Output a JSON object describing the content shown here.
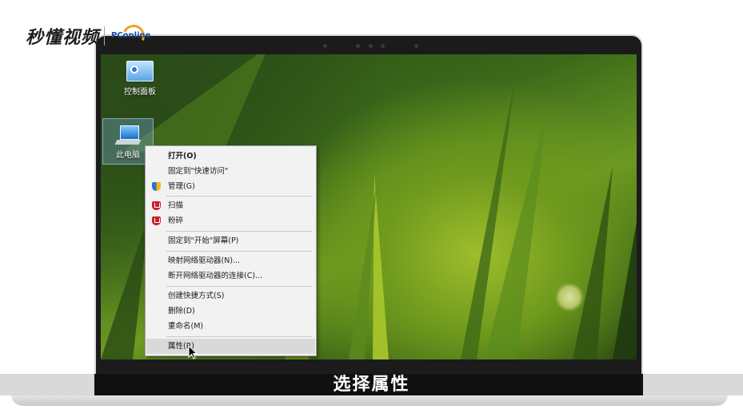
{
  "watermark": {
    "brand_text": "秒懂视频",
    "partner_text": "PConline"
  },
  "desktop": {
    "icons": [
      {
        "label": "控制面板",
        "icon": "control-panel-icon"
      },
      {
        "label": "此电脑",
        "icon": "this-pc-icon"
      }
    ]
  },
  "context_menu": {
    "items": [
      {
        "label": "打开(O)",
        "bold": true
      },
      {
        "label": "固定到\"快速访问\""
      },
      {
        "label": "管理(G)",
        "icon": "uac-shield-icon"
      },
      {
        "label": "扫描",
        "icon": "mcafee-icon"
      },
      {
        "label": "粉碎",
        "icon": "mcafee-icon"
      },
      {
        "label": "固定到\"开始\"屏幕(P)"
      },
      {
        "label": "映射网络驱动器(N)..."
      },
      {
        "label": "断开网络驱动器的连接(C)..."
      },
      {
        "label": "创建快捷方式(S)"
      },
      {
        "label": "删除(D)"
      },
      {
        "label": "重命名(M)"
      },
      {
        "label": "属性(R)",
        "highlighted": true
      }
    ]
  },
  "subtitle": "选择属性",
  "colors": {
    "menu_bg": "#f2f2f2",
    "highlight": "#d9d9d9",
    "subtitle_band": "#101010"
  }
}
